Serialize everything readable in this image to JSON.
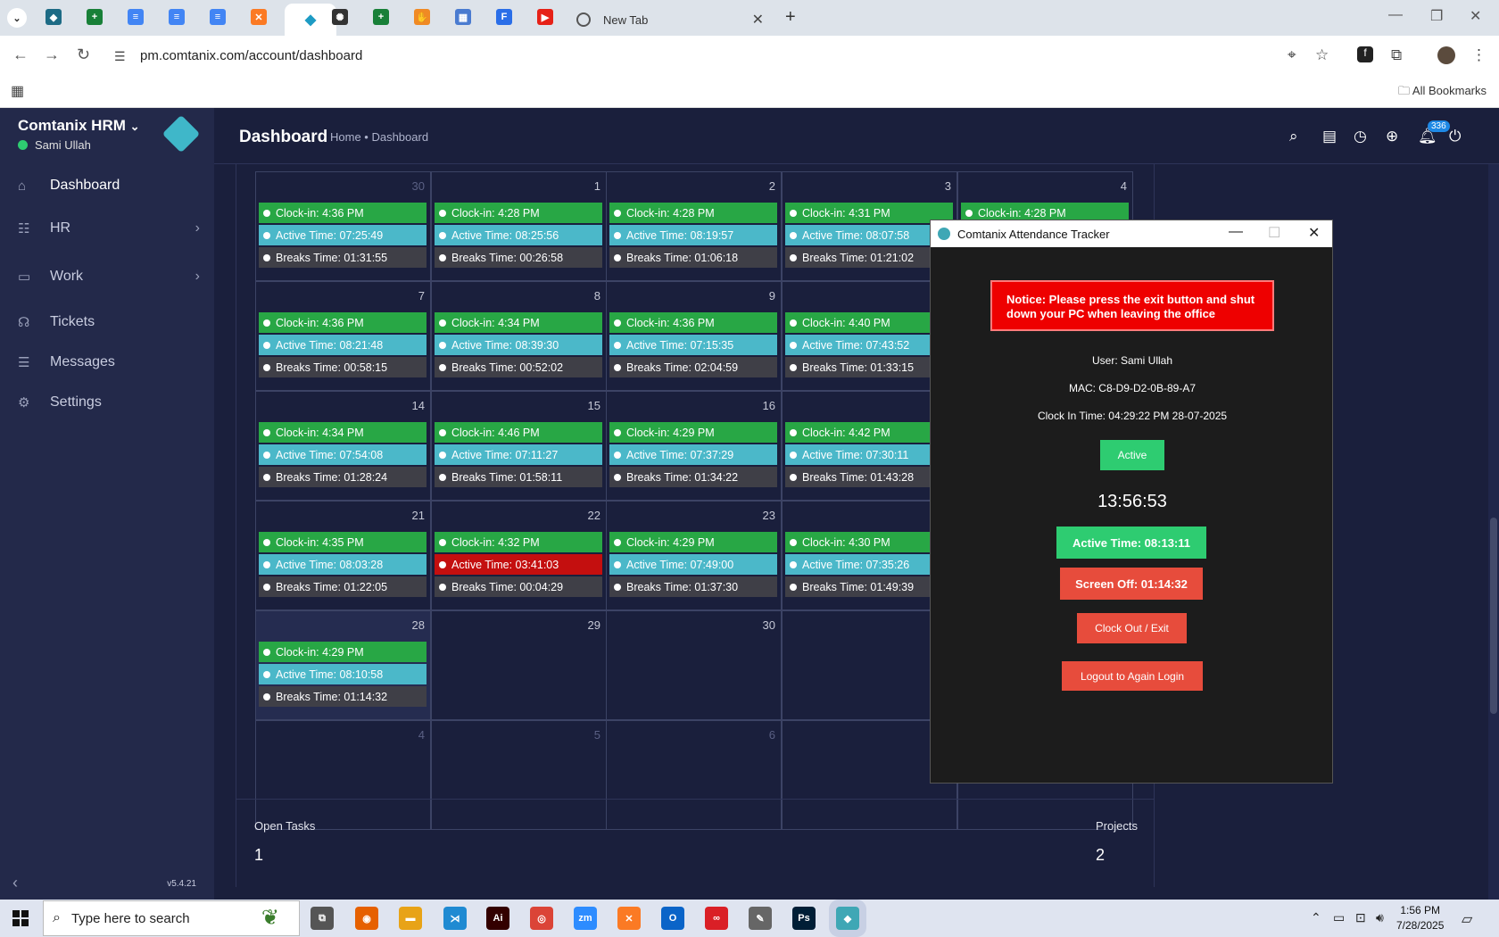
{
  "browser": {
    "tabs": [
      {
        "icon": "app-icon",
        "color": "#1d6b85",
        "glyph": "◆"
      },
      {
        "icon": "sheets-icon",
        "color": "#188038",
        "glyph": "+"
      },
      {
        "icon": "docs-icon",
        "color": "#4285f4",
        "glyph": "≡"
      },
      {
        "icon": "docs-icon",
        "color": "#4285f4",
        "glyph": "≡"
      },
      {
        "icon": "docs-icon",
        "color": "#4285f4",
        "glyph": "≡"
      },
      {
        "icon": "xampp-icon",
        "color": "#fb7a24",
        "glyph": "✕"
      },
      {
        "icon": "comtanix-icon",
        "color": "#1d9bc4",
        "glyph": "◆",
        "active": true
      },
      {
        "icon": "openai-icon",
        "color": "#333333",
        "glyph": "✺"
      },
      {
        "icon": "sheets-icon",
        "color": "#188038",
        "glyph": "+"
      },
      {
        "icon": "hand-icon",
        "color": "#f08a24",
        "glyph": "✋"
      },
      {
        "icon": "qr-icon",
        "color": "#4a7bd0",
        "glyph": "▦"
      },
      {
        "icon": "forms-icon",
        "color": "#2a6ee8",
        "glyph": "F"
      },
      {
        "icon": "youtube-icon",
        "color": "#e62117",
        "glyph": "▶"
      }
    ],
    "new_tab_label": "New Tab",
    "url": "pm.comtanix.com/account/dashboard",
    "bookmarks_label": "All Bookmarks"
  },
  "sidebar": {
    "brand": "Comtanix HRM",
    "user": "Sami Ullah",
    "version": "v5.4.21",
    "items": [
      {
        "label": "Dashboard",
        "icon": "home-icon",
        "glyph": "⌂",
        "active": true
      },
      {
        "label": "HR",
        "icon": "users-icon",
        "glyph": "☷",
        "chevron": true
      },
      {
        "label": "Work",
        "icon": "briefcase-icon",
        "glyph": "▭",
        "chevron": true
      },
      {
        "label": "Tickets",
        "icon": "headset-icon",
        "glyph": "☊"
      },
      {
        "label": "Messages",
        "icon": "message-icon",
        "glyph": "☰"
      },
      {
        "label": "Settings",
        "icon": "gear-icon",
        "glyph": "⚙"
      }
    ]
  },
  "header": {
    "title": "Dashboard",
    "breadcrumb": "Home • Dashboard",
    "notification_count": "336"
  },
  "calendar": {
    "weeks": [
      [
        {
          "day": "30",
          "dim": true,
          "events": [
            [
              "g",
              "Clock-in: 4:36 PM"
            ],
            [
              "c",
              "Active Time: 07:25:49"
            ],
            [
              "d",
              "Breaks Time: 01:31:55"
            ]
          ]
        },
        {
          "day": "1",
          "events": [
            [
              "g",
              "Clock-in: 4:28 PM"
            ],
            [
              "c",
              "Active Time: 08:25:56"
            ],
            [
              "d",
              "Breaks Time: 00:26:58"
            ]
          ]
        },
        {
          "day": "2",
          "events": [
            [
              "g",
              "Clock-in: 4:28 PM"
            ],
            [
              "c",
              "Active Time: 08:19:57"
            ],
            [
              "d",
              "Breaks Time: 01:06:18"
            ]
          ]
        },
        {
          "day": "3",
          "events": [
            [
              "g",
              "Clock-in: 4:31 PM"
            ],
            [
              "c",
              "Active Time: 08:07:58"
            ],
            [
              "d",
              "Breaks Time: 01:21:02"
            ]
          ]
        },
        {
          "day": "4",
          "events": [
            [
              "g",
              "Clock-in: 4:28 PM"
            ]
          ]
        }
      ],
      [
        {
          "day": "7",
          "events": [
            [
              "g",
              "Clock-in: 4:36 PM"
            ],
            [
              "c",
              "Active Time: 08:21:48"
            ],
            [
              "d",
              "Breaks Time: 00:58:15"
            ]
          ]
        },
        {
          "day": "8",
          "events": [
            [
              "g",
              "Clock-in: 4:34 PM"
            ],
            [
              "c",
              "Active Time: 08:39:30"
            ],
            [
              "d",
              "Breaks Time: 00:52:02"
            ]
          ]
        },
        {
          "day": "9",
          "events": [
            [
              "g",
              "Clock-in: 4:36 PM"
            ],
            [
              "c",
              "Active Time: 07:15:35"
            ],
            [
              "d",
              "Breaks Time: 02:04:59"
            ]
          ]
        },
        {
          "day": "",
          "events": [
            [
              "g",
              "Clock-in: 4:40 PM"
            ],
            [
              "c",
              "Active Time: 07:43:52"
            ],
            [
              "d",
              "Breaks Time: 01:33:15"
            ]
          ]
        },
        {
          "day": "",
          "events": []
        }
      ],
      [
        {
          "day": "14",
          "events": [
            [
              "g",
              "Clock-in: 4:34 PM"
            ],
            [
              "c",
              "Active Time: 07:54:08"
            ],
            [
              "d",
              "Breaks Time: 01:28:24"
            ]
          ]
        },
        {
          "day": "15",
          "events": [
            [
              "g",
              "Clock-in: 4:46 PM"
            ],
            [
              "c",
              "Active Time: 07:11:27"
            ],
            [
              "d",
              "Breaks Time: 01:58:11"
            ]
          ]
        },
        {
          "day": "16",
          "events": [
            [
              "g",
              "Clock-in: 4:29 PM"
            ],
            [
              "c",
              "Active Time: 07:37:29"
            ],
            [
              "d",
              "Breaks Time: 01:34:22"
            ]
          ]
        },
        {
          "day": "",
          "events": [
            [
              "g",
              "Clock-in: 4:42 PM"
            ],
            [
              "c",
              "Active Time: 07:30:11"
            ],
            [
              "d",
              "Breaks Time: 01:43:28"
            ]
          ]
        },
        {
          "day": "",
          "events": []
        }
      ],
      [
        {
          "day": "21",
          "events": [
            [
              "g",
              "Clock-in: 4:35 PM"
            ],
            [
              "c",
              "Active Time: 08:03:28"
            ],
            [
              "d",
              "Breaks Time: 01:22:05"
            ]
          ]
        },
        {
          "day": "22",
          "events": [
            [
              "g",
              "Clock-in: 4:32 PM"
            ],
            [
              "r",
              "Active Time: 03:41:03"
            ],
            [
              "d",
              "Breaks Time: 00:04:29"
            ]
          ]
        },
        {
          "day": "23",
          "events": [
            [
              "g",
              "Clock-in: 4:29 PM"
            ],
            [
              "c",
              "Active Time: 07:49:00"
            ],
            [
              "d",
              "Breaks Time: 01:37:30"
            ]
          ]
        },
        {
          "day": "",
          "events": [
            [
              "g",
              "Clock-in: 4:30 PM"
            ],
            [
              "c",
              "Active Time: 07:35:26"
            ],
            [
              "d",
              "Breaks Time: 01:49:39"
            ]
          ]
        },
        {
          "day": "",
          "events": []
        }
      ],
      [
        {
          "day": "28",
          "events": [
            [
              "g",
              "Clock-in: 4:29 PM"
            ],
            [
              "c",
              "Active Time: 08:10:58"
            ],
            [
              "d",
              "Breaks Time: 01:14:32"
            ]
          ]
        },
        {
          "day": "29",
          "events": []
        },
        {
          "day": "30",
          "events": []
        },
        {
          "day": "",
          "events": []
        },
        {
          "day": "",
          "events": []
        }
      ],
      [
        {
          "day": "4",
          "dim": true,
          "events": []
        },
        {
          "day": "5",
          "dim": true,
          "events": []
        },
        {
          "day": "6",
          "dim": true,
          "events": []
        },
        {
          "day": "",
          "events": []
        },
        {
          "day": "",
          "events": []
        }
      ]
    ]
  },
  "stats": {
    "open_tasks_label": "Open Tasks",
    "open_tasks_value": "1",
    "projects_label": "Projects",
    "projects_value": "2"
  },
  "tracker": {
    "title": "Comtanix Attendance Tracker",
    "notice": "Notice: Please press the exit button and shut down your PC when leaving the office",
    "user": "User: Sami Ullah",
    "mac": "MAC: C8-D9-D2-0B-89-A7",
    "clock_in": "Clock In Time: 04:29:22 PM 28-07-2025",
    "status": "Active",
    "timer": "13:56:53",
    "active_time": "Active Time: 08:13:11",
    "screen_off": "Screen Off: 01:14:32",
    "clock_out_label": "Clock Out / Exit",
    "logout_label": "Logout to Again Login"
  },
  "taskbar": {
    "search_placeholder": "Type here to search",
    "apps": [
      {
        "icon": "task-view-icon",
        "color": "#555555",
        "glyph": "⧉"
      },
      {
        "icon": "firefox-icon",
        "color": "#e66000",
        "glyph": "◉"
      },
      {
        "icon": "folder-icon",
        "color": "#e8a317",
        "glyph": "▬"
      },
      {
        "icon": "vscode-icon",
        "color": "#1f8ad2",
        "glyph": "⋊"
      },
      {
        "icon": "illustrator-icon",
        "color": "#330000",
        "glyph": "Ai"
      },
      {
        "icon": "chrome-icon",
        "color": "#db4437",
        "glyph": "◎"
      },
      {
        "icon": "zoom-icon",
        "color": "#2d8cff",
        "glyph": "zm"
      },
      {
        "icon": "xampp-icon",
        "color": "#fb7a24",
        "glyph": "✕"
      },
      {
        "icon": "outlook-icon",
        "color": "#0a64c8",
        "glyph": "O"
      },
      {
        "icon": "creative-cloud-icon",
        "color": "#da1f26",
        "glyph": "∞"
      },
      {
        "icon": "pen-icon",
        "color": "#666666",
        "glyph": "✎"
      },
      {
        "icon": "photoshop-icon",
        "color": "#001e36",
        "glyph": "Ps"
      },
      {
        "icon": "comtanix-icon",
        "color": "#3fa7b5",
        "glyph": "◆"
      }
    ],
    "time": "1:56 PM",
    "date": "7/28/2025"
  }
}
